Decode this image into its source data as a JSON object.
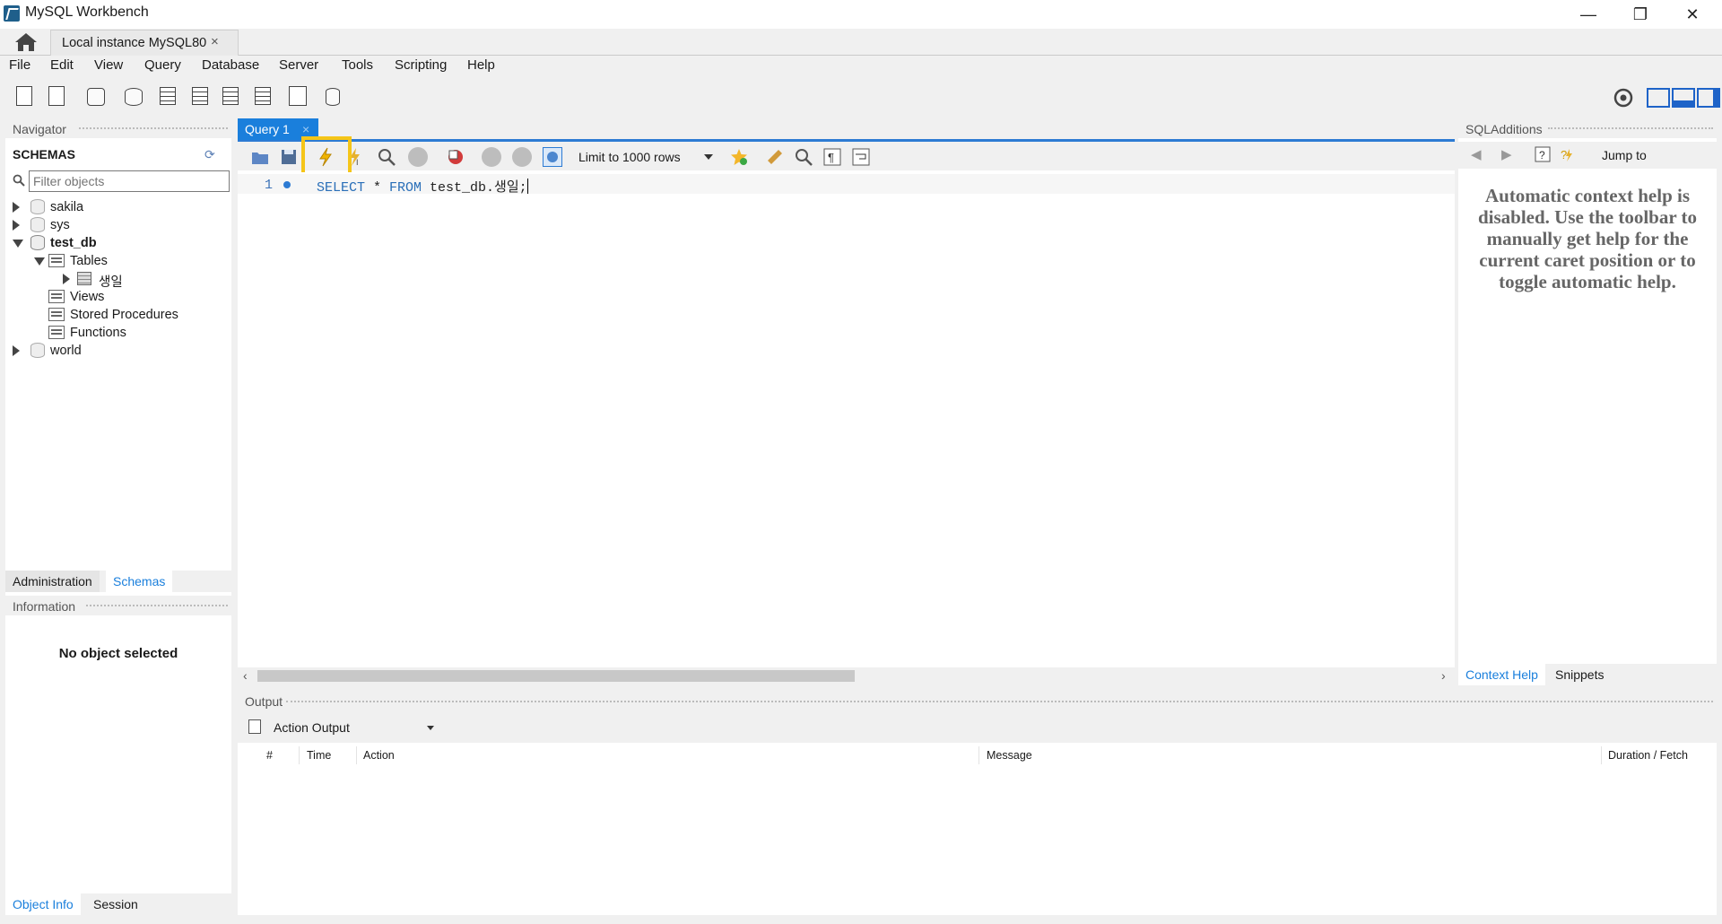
{
  "window": {
    "title": "MySQL Workbench",
    "minimize": "—",
    "maximize": "❐",
    "close": "✕"
  },
  "connection_tab": {
    "label": "Local instance MySQL80",
    "close": "×"
  },
  "menu": [
    "File",
    "Edit",
    "View",
    "Query",
    "Database",
    "Server",
    "Tools",
    "Scripting",
    "Help"
  ],
  "navigator": {
    "header": "Navigator",
    "schemas_title": "SCHEMAS",
    "filter_placeholder": "Filter objects",
    "tree": {
      "sakila": "sakila",
      "sys": "sys",
      "test_db": "test_db",
      "tables": "Tables",
      "table_1": "생일",
      "views": "Views",
      "stored_procedures": "Stored Procedures",
      "functions": "Functions",
      "world": "world"
    },
    "tabs": {
      "administration": "Administration",
      "schemas": "Schemas"
    }
  },
  "information": {
    "header": "Information",
    "no_object": "No object selected",
    "tabs": {
      "object_info": "Object Info",
      "session": "Session"
    }
  },
  "query_tab": {
    "label": "Query 1",
    "close": "×"
  },
  "editor_toolbar": {
    "limit": "Limit to 1000 rows"
  },
  "editor": {
    "line_number": "1",
    "sql_select": "SELECT",
    "sql_star": " * ",
    "sql_from": "FROM",
    "sql_rest": " test_db.생일;"
  },
  "sql_additions": {
    "header": "SQLAdditions",
    "jump_to": "Jump to",
    "help_text": "Automatic context help is disabled. Use the toolbar to manually get help for the current caret position or to toggle automatic help.",
    "tabs": {
      "context_help": "Context Help",
      "snippets": "Snippets"
    }
  },
  "output": {
    "header": "Output",
    "selector": "Action Output",
    "columns": {
      "num": "#",
      "time": "Time",
      "action": "Action",
      "message": "Message",
      "duration": "Duration / Fetch"
    }
  },
  "colors": {
    "accent": "#1a7fdc",
    "highlight_box": "#f5c518",
    "sql_keyword": "#2a6fb8",
    "help_text": "#666666"
  }
}
